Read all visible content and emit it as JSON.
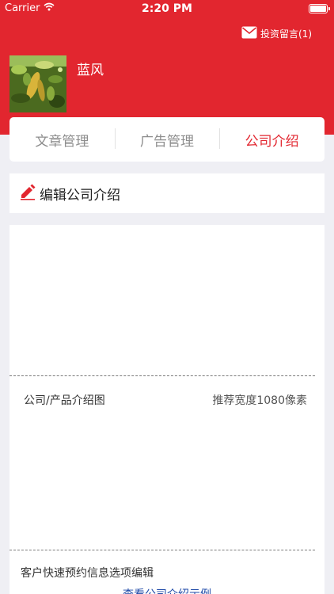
{
  "status": {
    "carrier": "Carrier",
    "time": "2:20 PM"
  },
  "header": {
    "message_link": "投资留言(1)",
    "username": "蓝风",
    "accent_color": "#e2262f"
  },
  "tabs": [
    {
      "label": "文章管理",
      "active": false
    },
    {
      "label": "广告管理",
      "active": false
    },
    {
      "label": "公司介绍",
      "active": true
    }
  ],
  "section": {
    "title": "编辑公司介绍",
    "icon": "pencil-icon"
  },
  "content": {
    "image_label": "公司/产品介绍图",
    "image_hint": "推荐宽度1080像素",
    "options_label": "客户快速预约信息选项编辑",
    "example_link": "查看公司介绍示例"
  }
}
